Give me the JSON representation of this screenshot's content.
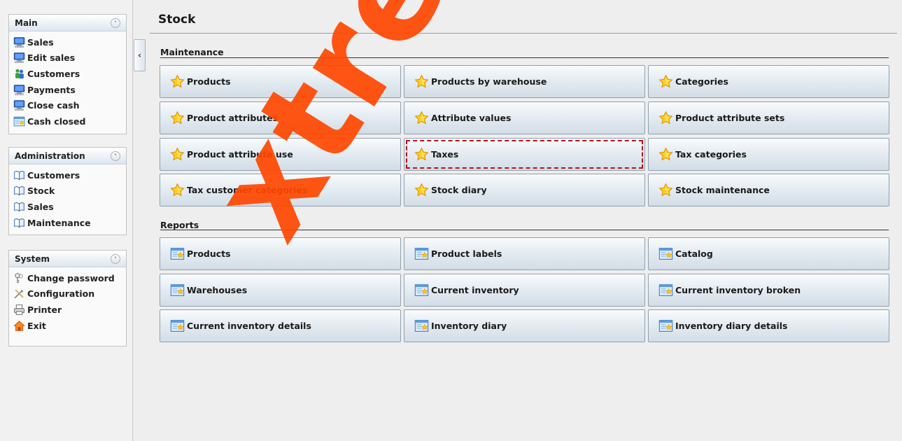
{
  "sidebar": {
    "panels": [
      {
        "title": "Main",
        "items": [
          {
            "label": "Sales",
            "icon": "monitor-icon"
          },
          {
            "label": "Edit sales",
            "icon": "monitor-icon"
          },
          {
            "label": "Customers",
            "icon": "people-icon"
          },
          {
            "label": "Payments",
            "icon": "monitor-icon"
          },
          {
            "label": "Close cash",
            "icon": "monitor-icon"
          },
          {
            "label": "Cash closed",
            "icon": "report-icon"
          }
        ]
      },
      {
        "title": "Administration",
        "items": [
          {
            "label": "Customers",
            "icon": "book-icon"
          },
          {
            "label": "Stock",
            "icon": "book-icon"
          },
          {
            "label": "Sales",
            "icon": "book-icon"
          },
          {
            "label": "Maintenance",
            "icon": "book-icon"
          }
        ]
      },
      {
        "title": "System",
        "items": [
          {
            "label": "Change password",
            "icon": "keys-icon"
          },
          {
            "label": "Configuration",
            "icon": "tools-icon"
          },
          {
            "label": "Printer",
            "icon": "printer-icon"
          },
          {
            "label": "Exit",
            "icon": "home-icon"
          }
        ]
      }
    ],
    "collapse_glyph": "‹",
    "panel_toggle_glyph": "˄"
  },
  "main": {
    "title": "Stock",
    "sections": [
      {
        "label": "Maintenance",
        "buttons": [
          {
            "label": "Products",
            "icon": "star-icon"
          },
          {
            "label": "Products by warehouse",
            "icon": "star-icon"
          },
          {
            "label": "Categories",
            "icon": "star-icon"
          },
          {
            "label": "Product attributes",
            "icon": "star-icon"
          },
          {
            "label": "Attribute values",
            "icon": "star-icon"
          },
          {
            "label": "Product attribute sets",
            "icon": "star-icon"
          },
          {
            "label": "Product attribute use",
            "icon": "star-icon"
          },
          {
            "label": "Taxes",
            "icon": "star-icon",
            "focused": true
          },
          {
            "label": "Tax categories",
            "icon": "star-icon"
          },
          {
            "label": "Tax customer categories",
            "icon": "star-icon"
          },
          {
            "label": "Stock diary",
            "icon": "star-icon"
          },
          {
            "label": "Stock maintenance",
            "icon": "star-icon"
          }
        ]
      },
      {
        "label": "Reports",
        "buttons": [
          {
            "label": "Products",
            "icon": "report-icon"
          },
          {
            "label": "Product labels",
            "icon": "report-icon"
          },
          {
            "label": "Catalog",
            "icon": "report-icon"
          },
          {
            "label": "Warehouses",
            "icon": "report-icon"
          },
          {
            "label": "Current inventory",
            "icon": "report-icon"
          },
          {
            "label": "Current inventory broken",
            "icon": "report-icon"
          },
          {
            "label": "Current inventory details",
            "icon": "report-icon"
          },
          {
            "label": "Inventory diary",
            "icon": "report-icon"
          },
          {
            "label": "Inventory diary details",
            "icon": "report-icon"
          }
        ]
      }
    ]
  },
  "watermark": "xtreme",
  "colors": {
    "focus_border": "#b5121b",
    "watermark": "#ff4600"
  }
}
